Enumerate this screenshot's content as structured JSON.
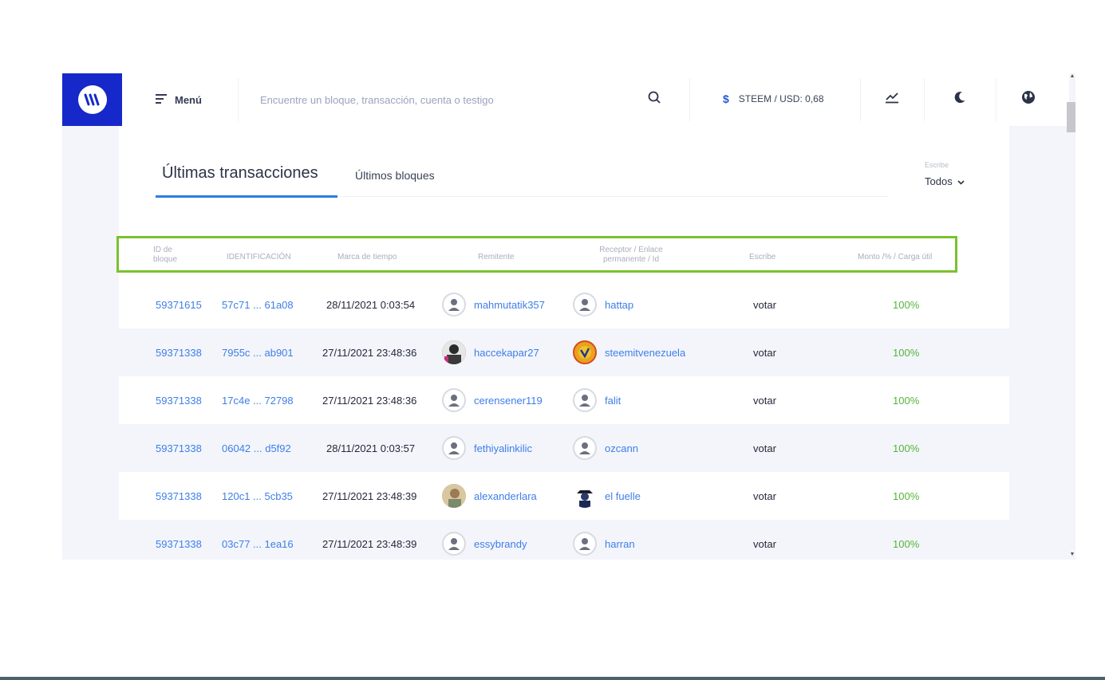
{
  "header": {
    "menu_label": "Menú",
    "search_placeholder": "Encuentre un bloque, transacción, cuenta o testigo",
    "price_label": "STEEM / USD: 0,68",
    "price_symbol": "$"
  },
  "tabs": {
    "active": "Últimas transacciones",
    "inactive": "Últimos bloques"
  },
  "filter": {
    "label": "Escribe",
    "value": "Todos"
  },
  "table": {
    "headers": {
      "block_id_1": "ID de",
      "block_id_2": "bloque",
      "identification": "IDENTIFICACIÓN",
      "timestamp": "Marca de tiempo",
      "sender": "Remitente",
      "receiver_1": "Receptor / Enlace",
      "receiver_2": "permanente / Id",
      "type": "Escribe",
      "amount": "Monto /% / Carga útil"
    },
    "rows": [
      {
        "block": "59371615",
        "id": "57c71 ... 61a08",
        "time": "28/11/2021 0:03:54",
        "sender": "mahmutatik357",
        "receiver": "hattap",
        "type": "votar",
        "amount": "100%"
      },
      {
        "block": "59371338",
        "id": "7955c ... ab901",
        "time": "27/11/2021 23:48:36",
        "sender": "haccekapar27",
        "receiver": "steemitvenezuela",
        "type": "votar",
        "amount": "100%"
      },
      {
        "block": "59371338",
        "id": "17c4e ... 72798",
        "time": "27/11/2021 23:48:36",
        "sender": "cerensener119",
        "receiver": "falit",
        "type": "votar",
        "amount": "100%"
      },
      {
        "block": "59371338",
        "id": "06042 ... d5f92",
        "time": "28/11/2021 0:03:57",
        "sender": "fethiyalinkilic",
        "receiver": "ozcann",
        "type": "votar",
        "amount": "100%"
      },
      {
        "block": "59371338",
        "id": "120c1 ... 5cb35",
        "time": "27/11/2021 23:48:39",
        "sender": "alexanderlara",
        "receiver": "el fuelle",
        "type": "votar",
        "amount": "100%"
      },
      {
        "block": "59371338",
        "id": "03c77 ... 1ea16",
        "time": "27/11/2021 23:48:39",
        "sender": "essybrandy",
        "receiver": "harran",
        "type": "votar",
        "amount": "100%"
      }
    ]
  },
  "colors": {
    "brand": "#1628c9",
    "link": "#3f7ee8",
    "success": "#53b53a",
    "highlight": "#7ac22f"
  }
}
